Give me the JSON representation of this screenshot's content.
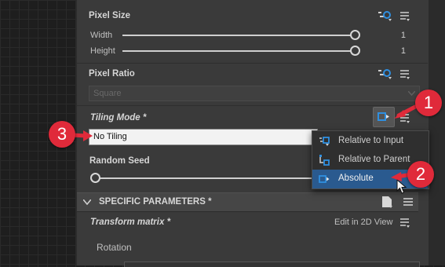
{
  "pixel_size": {
    "title": "Pixel Size",
    "width_label": "Width",
    "width_value": "1",
    "width_level": 1.0,
    "height_label": "Height",
    "height_value": "1",
    "height_level": 1.0
  },
  "pixel_ratio": {
    "title": "Pixel Ratio",
    "selected": "Square"
  },
  "tiling_mode": {
    "title": "Tiling Mode *",
    "selected": "No Tiling",
    "menu": [
      {
        "label": "Relative to Input",
        "icon": "relative-input-icon"
      },
      {
        "label": "Relative to Parent",
        "icon": "relative-parent-icon"
      },
      {
        "label": "Absolute",
        "icon": "absolute-icon",
        "highlighted": true
      }
    ]
  },
  "random_seed": {
    "title": "Random Seed"
  },
  "specific_parameters": {
    "title": "SPECIFIC PARAMETERS *"
  },
  "transform_matrix": {
    "title": "Transform matrix *",
    "edit_label": "Edit in 2D View",
    "rotation_label": "Rotation"
  },
  "callouts": [
    "1",
    "2",
    "3"
  ],
  "colors": {
    "accent_blue": "#2f8fe0",
    "highlight_row": "#2a5a8f",
    "callout_red": "#e02a3a"
  }
}
